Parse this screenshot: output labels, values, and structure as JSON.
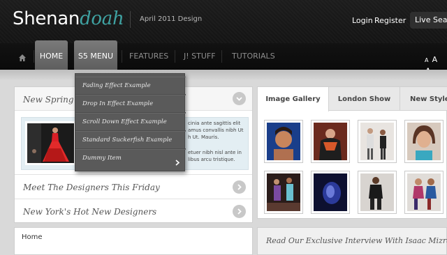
{
  "header": {
    "logo_part1": "Shenan",
    "logo_part2": "doah",
    "tagline": "April 2011 Design",
    "login": "Login",
    "register": "Register",
    "live_search": "Live Search"
  },
  "nav": {
    "items": [
      "HOME",
      "S5 MENU",
      "FEATURES",
      "J! STUFF",
      "TUTORIALS"
    ],
    "font_sizes": [
      "A",
      "A",
      "A"
    ]
  },
  "dropdown": {
    "items": [
      "Fading Effect Example",
      "Drop In Effect Example",
      "Scroll Down Effect Example",
      "Standard Suckerfish Example",
      "Dummy Item"
    ]
  },
  "accordion": {
    "first_title": "New Spring B",
    "feature_text": [
      "cinia ante sagittis elit",
      "amus convallis nibh Ut",
      "h Ut. Mauris.",
      "",
      "etuer nibh nisl ante in",
      "libus arcu tristique."
    ],
    "row2": "Meet The Designers This Friday",
    "row3": "New York's Hot New Designers"
  },
  "breadcrumb": "Home",
  "tabs": [
    "Image Gallery",
    "London Show",
    "New Styles"
  ],
  "interview": "Read Our Exclusive Interview With Isaac Mizrahi",
  "colors": {
    "accent": "#3fa3a3",
    "header_bg": "#1c1c1c",
    "nav_active": "#6e6e6e",
    "dropdown_bg": "#5a5a5a"
  }
}
